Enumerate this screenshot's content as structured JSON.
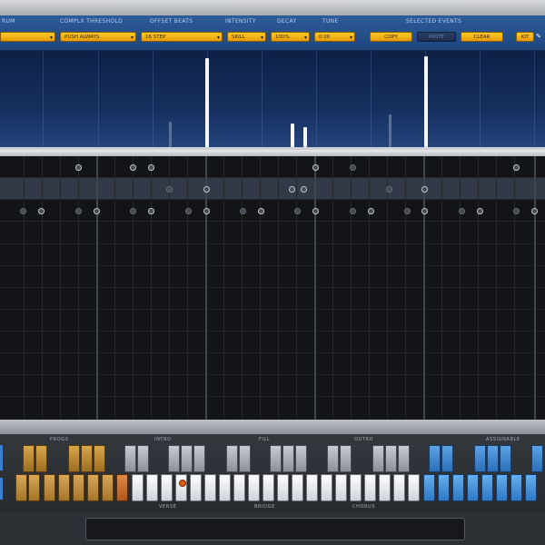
{
  "top_panel": {
    "labels": {
      "drum": "RUM",
      "complex_threshold": "COMPLX THRESHOLD",
      "offset_beats": "OFFSET BEATS",
      "intensity": "INTENSITY",
      "decay": "DECAY",
      "tune": "TUNE",
      "selected_events": "SELECTED EVENTS"
    },
    "values": {
      "drum": "",
      "complex_threshold": "PUSH ALWAYS",
      "offset_beats": "16 STEP",
      "intensity": "SKILL",
      "decay": "100%",
      "tune": "0.00"
    },
    "buttons": {
      "copy": "COPY",
      "paste": "PASTE",
      "clear": "CLEAR",
      "kit": "KIT"
    }
  },
  "keyboard_sections": {
    "prog": "PROGS",
    "intro": "INTRO",
    "fill": "FILL",
    "outro": "OUTRO",
    "assignable": "ASSIGNABLE",
    "verse": "VERSE",
    "bridge": "BRIDGE",
    "chorus": "CHORUS"
  },
  "colors": {
    "accent_gold": "#f0b020",
    "panel_blue": "#1d467d",
    "key_blue": "#3a86d6"
  }
}
